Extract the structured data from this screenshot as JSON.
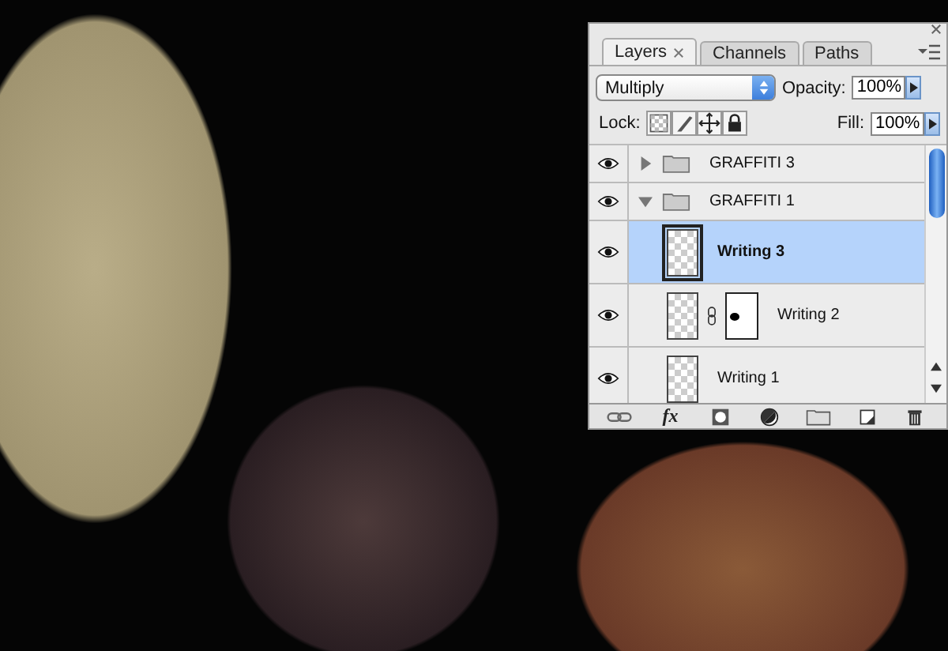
{
  "panel": {
    "tabs": [
      {
        "label": "Layers",
        "selected": true
      },
      {
        "label": "Channels",
        "selected": false
      },
      {
        "label": "Paths",
        "selected": false
      }
    ],
    "blend_mode": "Multiply",
    "opacity_label": "Opacity:",
    "opacity": "100%",
    "lock_label": "Lock:",
    "fill_label": "Fill:",
    "fill": "100%",
    "layers": [
      {
        "kind": "group",
        "name": "GRAFFITI 3",
        "visible": true,
        "expanded": false,
        "selected": false
      },
      {
        "kind": "group",
        "name": "GRAFFITI 1",
        "visible": true,
        "expanded": true,
        "selected": false,
        "children": [
          {
            "kind": "layer",
            "name": "Writing 3",
            "visible": true,
            "selected": true,
            "mask": false
          },
          {
            "kind": "layer",
            "name": "Writing 2",
            "visible": true,
            "selected": false,
            "mask": true
          },
          {
            "kind": "layer",
            "name": "Writing 1",
            "visible": true,
            "selected": false,
            "mask": false
          }
        ]
      }
    ],
    "fx_label": "fx"
  }
}
